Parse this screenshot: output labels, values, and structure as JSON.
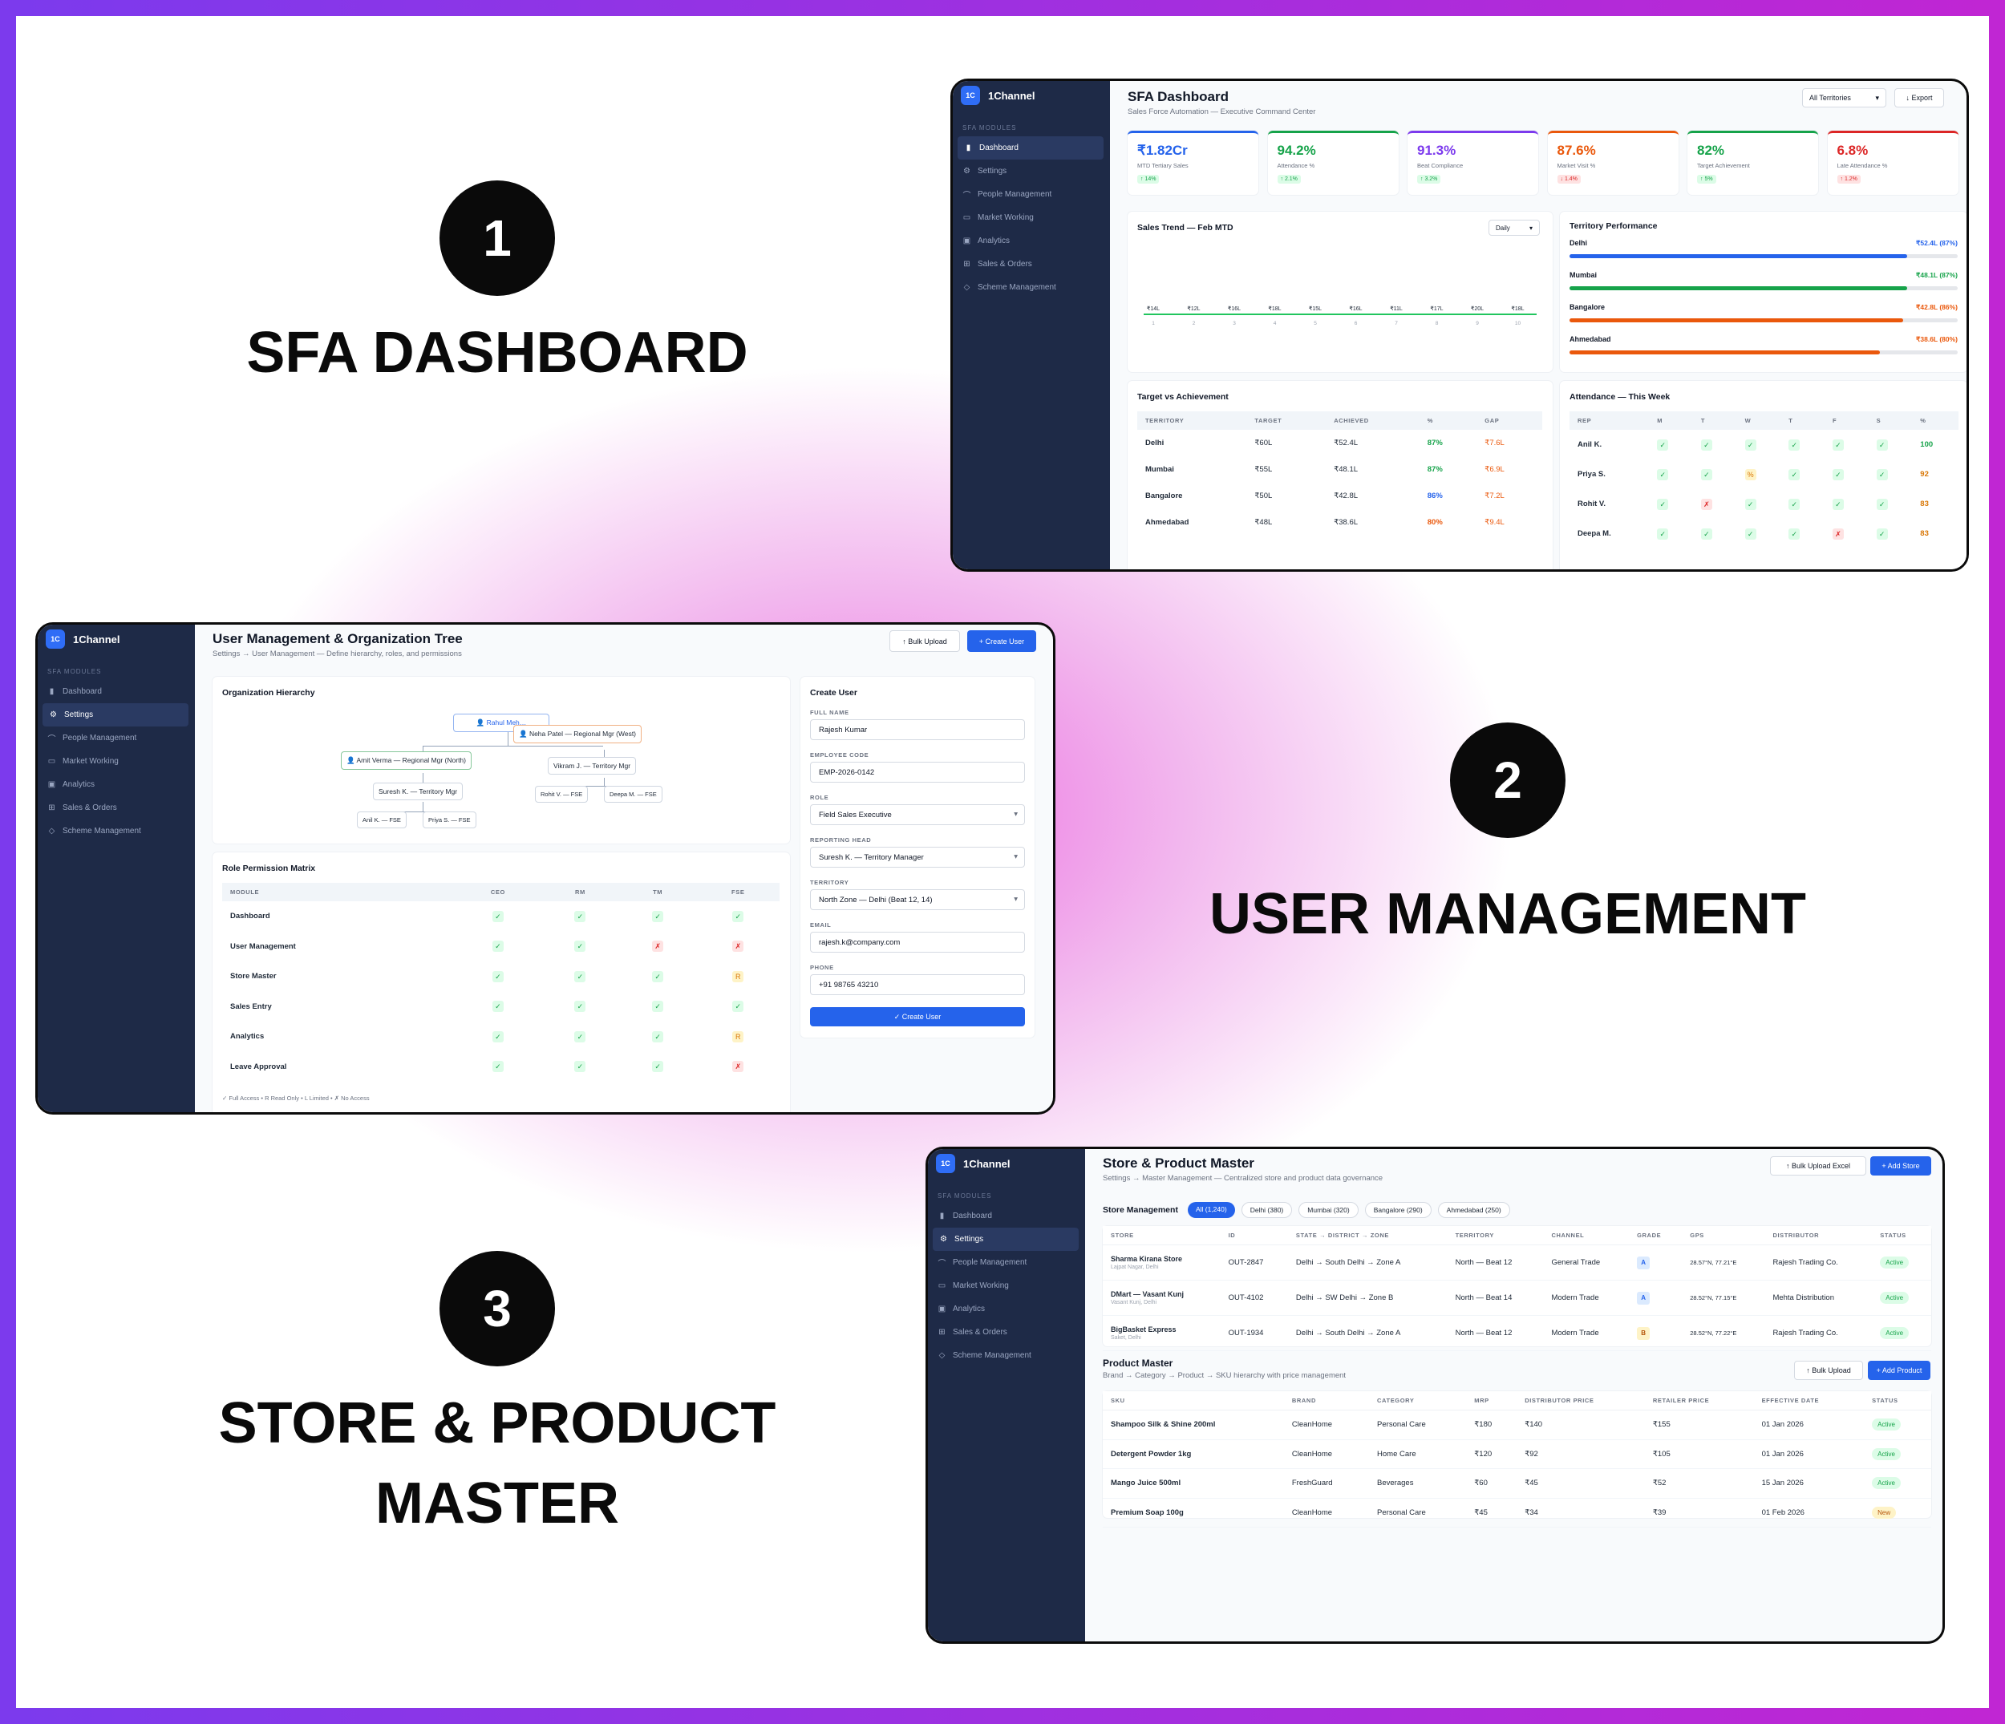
{
  "panels": [
    {
      "number": "1",
      "title": "SFA DASHBOARD"
    },
    {
      "number": "2",
      "title": "USER MANAGEMENT"
    },
    {
      "number": "3",
      "title": "STORE & PRODUCT",
      "title2": "MASTER"
    }
  ],
  "app": {
    "brand": "1Channel",
    "logo": "1C",
    "section": "SFA MODULES",
    "nav": [
      "Dashboard",
      "Settings",
      "People Management",
      "Market Working",
      "Analytics",
      "Sales & Orders",
      "Scheme Management"
    ]
  },
  "dash": {
    "title": "SFA Dashboard",
    "subtitle": "Sales Force Automation — Executive Command Center",
    "filter": "All Territories",
    "export": "↓ Export",
    "kpis": [
      {
        "value": "₹1.82Cr",
        "label": "MTD Tertiary Sales",
        "delta": "↑ 14%",
        "color": "#2563eb",
        "up": true
      },
      {
        "value": "94.2%",
        "label": "Attendance %",
        "delta": "↑ 2.1%",
        "color": "#16a34a",
        "up": true
      },
      {
        "value": "91.3%",
        "label": "Beat Compliance",
        "delta": "↑ 3.2%",
        "color": "#7c3aed",
        "up": true
      },
      {
        "value": "87.6%",
        "label": "Market Visit %",
        "delta": "↓ 1.4%",
        "color": "#ea580c",
        "up": false
      },
      {
        "value": "82%",
        "label": "Target Achievement",
        "delta": "↑ 5%",
        "color": "#16a34a",
        "up": true
      },
      {
        "value": "6.8%",
        "label": "Late Attendance %",
        "delta": "↑ 1.2%",
        "color": "#dc2626",
        "up": false
      }
    ],
    "trend_title": "Sales Trend — Feb MTD",
    "trend_mode": "Daily",
    "trend_labels": [
      "₹14L",
      "₹12L",
      "₹16L",
      "₹18L",
      "₹15L",
      "₹16L",
      "₹11L",
      "₹17L",
      "₹20L",
      "₹18L"
    ],
    "trend_days": [
      "1",
      "2",
      "3",
      "4",
      "5",
      "6",
      "7",
      "8",
      "9",
      "10"
    ],
    "territory_title": "Territory Performance",
    "territories": [
      {
        "name": "Delhi",
        "value": "₹52.4L (87%)",
        "pct": 87,
        "color": "#2563eb"
      },
      {
        "name": "Mumbai",
        "value": "₹48.1L (87%)",
        "pct": 87,
        "color": "#16a34a"
      },
      {
        "name": "Bangalore",
        "value": "₹42.8L (86%)",
        "pct": 86,
        "color": "#ea580c"
      },
      {
        "name": "Ahmedabad",
        "value": "₹38.6L (80%)",
        "pct": 80,
        "color": "#ea580c"
      }
    ],
    "tva_title": "Target vs Achievement",
    "tva_cols": [
      "TERRITORY",
      "TARGET",
      "ACHIEVED",
      "%",
      "GAP"
    ],
    "tva_rows": [
      {
        "t": "Delhi",
        "target": "₹60L",
        "ach": "₹52.4L",
        "pct": "87%",
        "gap": "₹7.6L",
        "pc": "#16a34a"
      },
      {
        "t": "Mumbai",
        "target": "₹55L",
        "ach": "₹48.1L",
        "pct": "87%",
        "gap": "₹6.9L",
        "pc": "#16a34a"
      },
      {
        "t": "Bangalore",
        "target": "₹50L",
        "ach": "₹42.8L",
        "pct": "86%",
        "gap": "₹7.2L",
        "pc": "#2563eb"
      },
      {
        "t": "Ahmedabad",
        "target": "₹48L",
        "ach": "₹38.6L",
        "pct": "80%",
        "gap": "₹9.4L",
        "pc": "#ea580c"
      }
    ],
    "att_title": "Attendance — This Week",
    "att_cols": [
      "REP",
      "M",
      "T",
      "W",
      "T",
      "F",
      "S",
      "%"
    ],
    "att_rows": [
      {
        "rep": "Anil K.",
        "days": [
          "g",
          "g",
          "g",
          "g",
          "g",
          "g"
        ],
        "pct": "100",
        "pc": "#16a34a"
      },
      {
        "rep": "Priya S.",
        "days": [
          "g",
          "g",
          "y",
          "g",
          "g",
          "g"
        ],
        "pct": "92",
        "pc": "#d97706"
      },
      {
        "rep": "Rohit V.",
        "days": [
          "g",
          "r",
          "g",
          "g",
          "g",
          "g"
        ],
        "pct": "83",
        "pc": "#d97706"
      },
      {
        "rep": "Deepa M.",
        "days": [
          "g",
          "g",
          "g",
          "g",
          "r",
          "g"
        ],
        "pct": "83",
        "pc": "#d97706"
      }
    ]
  },
  "um": {
    "title": "User Management & Organization Tree",
    "subtitle": "Settings → User Management — Define hierarchy, roles, and permissions",
    "bulk": "↑ Bulk Upload",
    "create": "+ Create User",
    "org_title": "Organization Hierarchy",
    "nodes": {
      "ceo": "👤 Rahul Meh…",
      "west": "👤 Neha Patel — Regional Mgr (West)",
      "north": "👤 Amit Verma — Regional Mgr (North)",
      "tm1": "Suresh K. — Territory Mgr",
      "tm2": "Vikram J. — Territory Mgr",
      "f1": "Anil K. — FSE",
      "f2": "Priya S. — FSE",
      "f3": "Rohit V. — FSE",
      "f4": "Deepa M. — FSE"
    },
    "perm_title": "Role Permission Matrix",
    "perm_cols": [
      "MODULE",
      "CEO",
      "RM",
      "TM",
      "FSE"
    ],
    "perm_rows": [
      {
        "m": "Dashboard",
        "v": [
          "g",
          "g",
          "g",
          "g"
        ]
      },
      {
        "m": "User Management",
        "v": [
          "g",
          "g",
          "r",
          "r"
        ]
      },
      {
        "m": "Store Master",
        "v": [
          "g",
          "g",
          "g",
          "y"
        ]
      },
      {
        "m": "Sales Entry",
        "v": [
          "g",
          "g",
          "g",
          "g"
        ]
      },
      {
        "m": "Analytics",
        "v": [
          "g",
          "g",
          "g",
          "y"
        ]
      },
      {
        "m": "Leave Approval",
        "v": [
          "g",
          "g",
          "g",
          "r"
        ]
      }
    ],
    "legend": "✓ Full Access • R Read Only • L Limited • ✗ No Access",
    "form_title": "Create User",
    "fields": [
      {
        "label": "FULL NAME",
        "value": "Rajesh Kumar",
        "select": false
      },
      {
        "label": "EMPLOYEE CODE",
        "value": "EMP-2026-0142",
        "select": false
      },
      {
        "label": "ROLE",
        "value": "Field Sales Executive",
        "select": true
      },
      {
        "label": "REPORTING HEAD",
        "value": "Suresh K. — Territory Manager",
        "select": true
      },
      {
        "label": "TERRITORY",
        "value": "North Zone — Delhi (Beat 12, 14)",
        "select": true
      },
      {
        "label": "EMAIL",
        "value": "rajesh.k@company.com",
        "select": false
      },
      {
        "label": "PHONE",
        "value": "+91 98765 43210",
        "select": false
      }
    ],
    "submit": "✓ Create User"
  },
  "sp": {
    "title": "Store & Product Master",
    "subtitle": "Settings → Master Management — Centralized store and product data governance",
    "bulk": "↑ Bulk Upload Excel",
    "add": "+ Add Store",
    "store_title": "Store Management",
    "chips": [
      "All (1,240)",
      "Delhi (380)",
      "Mumbai (320)",
      "Bangalore (290)",
      "Ahmedabad (250)"
    ],
    "store_cols": [
      "STORE",
      "ID",
      "STATE → DISTRICT → ZONE",
      "TERRITORY",
      "CHANNEL",
      "GRADE",
      "GPS",
      "DISTRIBUTOR",
      "STATUS"
    ],
    "stores": [
      {
        "name": "Sharma Kirana Store",
        "loc": "Lajpat Nagar, Delhi",
        "id": "OUT-2847",
        "zone": "Delhi → South Delhi → Zone A",
        "terr": "North — Beat 12",
        "ch": "General Trade",
        "grade": "A",
        "gps": "28.57°N, 77.21°E",
        "dist": "Rajesh Trading Co.",
        "status": "Active"
      },
      {
        "name": "DMart — Vasant Kunj",
        "loc": "Vasant Kunj, Delhi",
        "id": "OUT-4102",
        "zone": "Delhi → SW Delhi → Zone B",
        "terr": "North — Beat 14",
        "ch": "Modern Trade",
        "grade": "A",
        "gps": "28.52°N, 77.15°E",
        "dist": "Mehta Distribution",
        "status": "Active"
      },
      {
        "name": "BigBasket Express",
        "loc": "Saket, Delhi",
        "id": "OUT-1934",
        "zone": "Delhi → South Delhi → Zone A",
        "terr": "North — Beat 12",
        "ch": "Modern Trade",
        "grade": "B",
        "gps": "28.52°N, 77.22°E",
        "dist": "Rajesh Trading Co.",
        "status": "Active"
      }
    ],
    "prod_title": "Product Master",
    "prod_sub": "Brand → Category → Product → SKU hierarchy with price management",
    "prod_bulk": "↑ Bulk Upload",
    "prod_add": "+ Add Product",
    "prod_cols": [
      "SKU",
      "BRAND",
      "CATEGORY",
      "MRP",
      "DISTRIBUTOR PRICE",
      "RETAILER PRICE",
      "EFFECTIVE DATE",
      "STATUS"
    ],
    "products": [
      {
        "sku": "Shampoo Silk & Shine 200ml",
        "brand": "CleanHome",
        "cat": "Personal Care",
        "mrp": "₹180",
        "dp": "₹140",
        "rp": "₹155",
        "date": "01 Jan 2026",
        "status": "Active"
      },
      {
        "sku": "Detergent Powder 1kg",
        "brand": "CleanHome",
        "cat": "Home Care",
        "mrp": "₹120",
        "dp": "₹92",
        "rp": "₹105",
        "date": "01 Jan 2026",
        "status": "Active"
      },
      {
        "sku": "Mango Juice 500ml",
        "brand": "FreshGuard",
        "cat": "Beverages",
        "mrp": "₹60",
        "dp": "₹45",
        "rp": "₹52",
        "date": "15 Jan 2026",
        "status": "Active"
      },
      {
        "sku": "Premium Soap 100g",
        "brand": "CleanHome",
        "cat": "Personal Care",
        "mrp": "₹45",
        "dp": "₹34",
        "rp": "₹39",
        "date": "01 Feb 2026",
        "status": "New"
      }
    ]
  }
}
